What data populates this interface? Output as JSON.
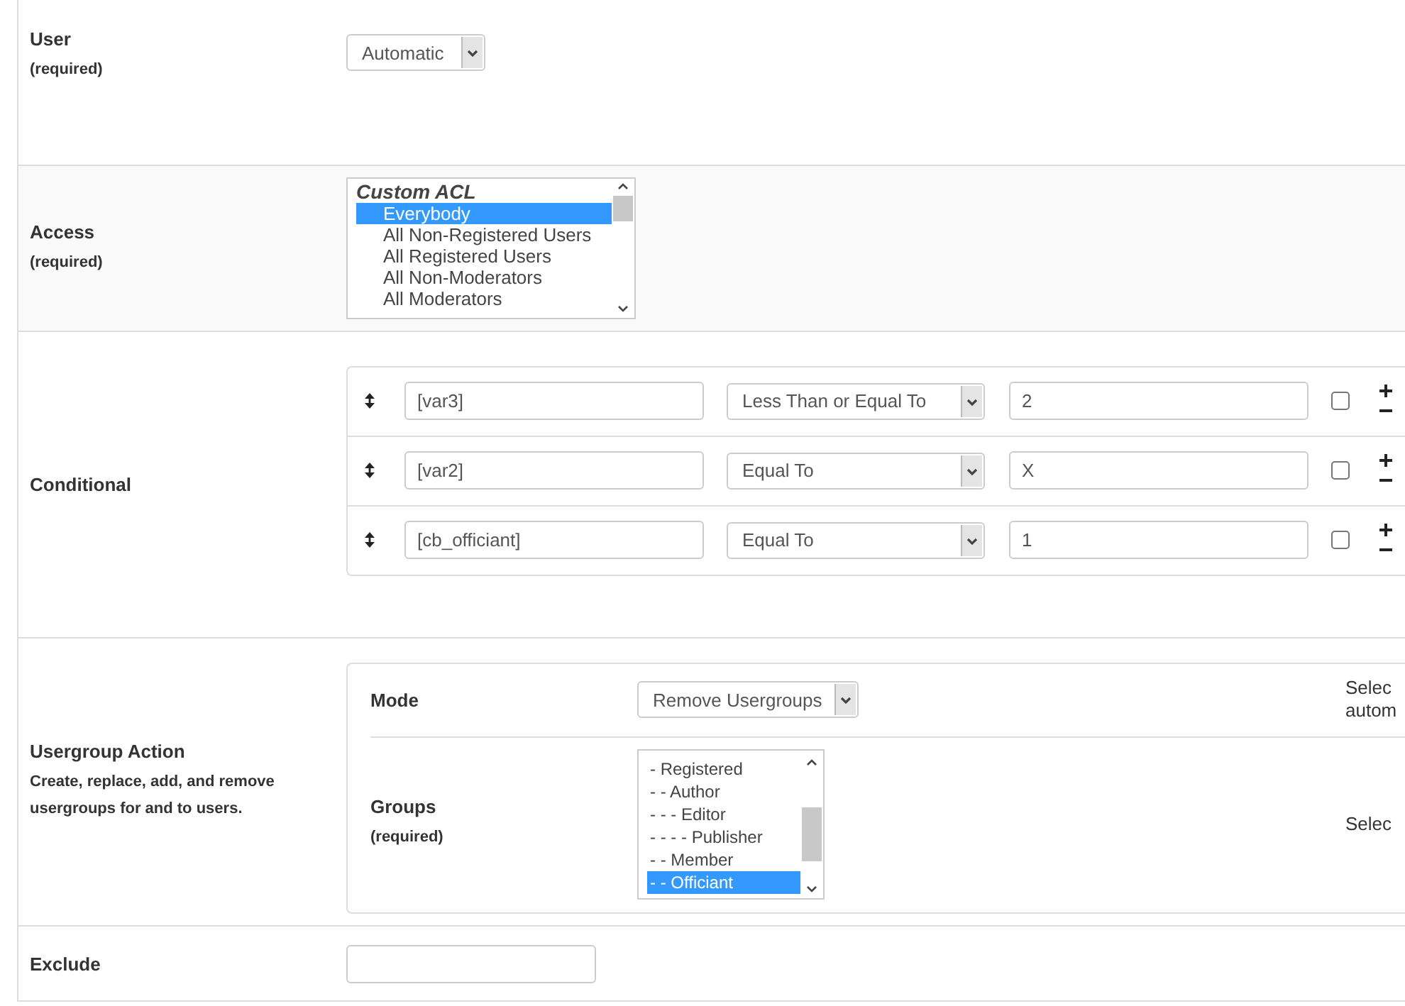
{
  "user": {
    "label": "User",
    "note": "(required)",
    "select": {
      "value": "Automatic"
    }
  },
  "access": {
    "label": "Access",
    "note": "(required)",
    "list": [
      {
        "kind": "group",
        "text": "Custom ACL",
        "selected": false
      },
      {
        "kind": "option",
        "text": "Everybody",
        "selected": true
      },
      {
        "kind": "option",
        "text": "All Non-Registered Users",
        "selected": false
      },
      {
        "kind": "option",
        "text": "All Registered Users",
        "selected": false
      },
      {
        "kind": "option",
        "text": "All Non-Moderators",
        "selected": false
      },
      {
        "kind": "option",
        "text": "All Moderators",
        "selected": false
      }
    ]
  },
  "conditional": {
    "label": "Conditional",
    "rows": [
      {
        "field": "[var3]",
        "operator": "Less Than or Equal To",
        "value": "2",
        "checked": false
      },
      {
        "field": "[var2]",
        "operator": "Equal To",
        "value": "X",
        "checked": false
      },
      {
        "field": "[cb_officiant]",
        "operator": "Equal To",
        "value": "1",
        "checked": false
      }
    ]
  },
  "usergroup_action": {
    "label": "Usergroup Action",
    "description": "Create, replace, add, and remove usergroups for and to users.",
    "mode": {
      "label": "Mode",
      "value": "Remove Usergroups",
      "help": [
        "Selec",
        "autom"
      ]
    },
    "groups": {
      "label": "Groups",
      "note": "(required)",
      "help": [
        "Selec"
      ],
      "list": [
        {
          "text": "- Registered",
          "selected": false
        },
        {
          "text": "- - Author",
          "selected": false
        },
        {
          "text": "- - - Editor",
          "selected": false
        },
        {
          "text": "- - - - Publisher",
          "selected": false
        },
        {
          "text": "- - Member",
          "selected": false
        },
        {
          "text": "- - Officiant",
          "selected": true
        }
      ]
    }
  },
  "exclude": {
    "label": "Exclude"
  }
}
